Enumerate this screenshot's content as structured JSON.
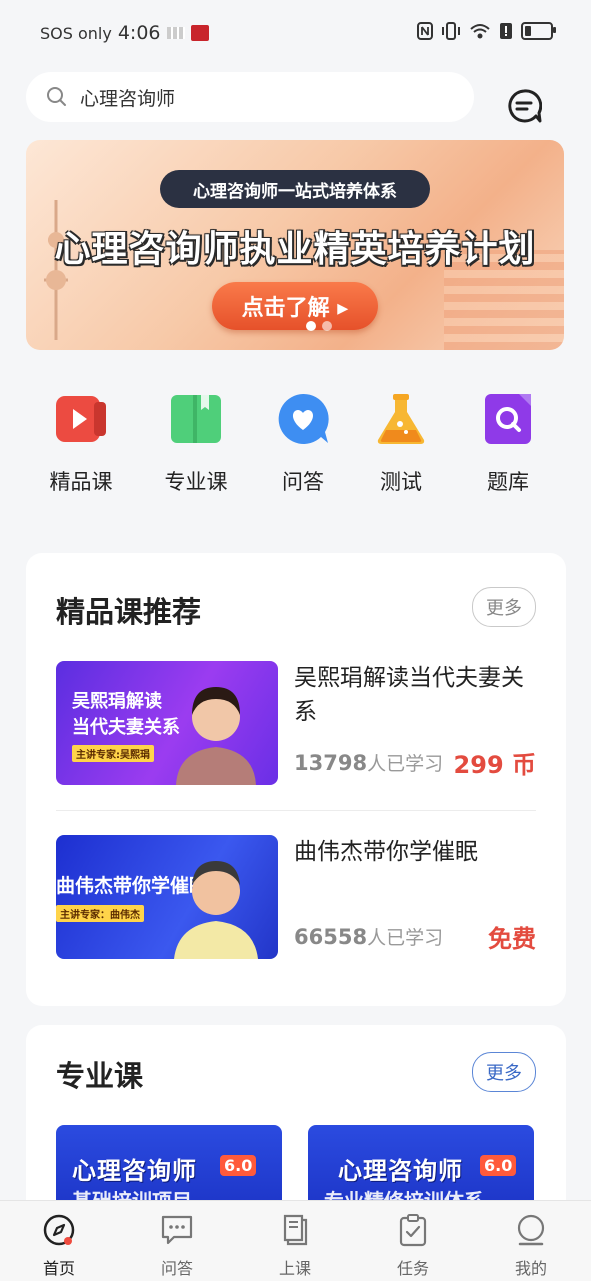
{
  "status_bar": {
    "carrier": "SOS only",
    "time": "4:06"
  },
  "search": {
    "value": "心理咨询师"
  },
  "banner": {
    "pill": "心理咨询师一站式培养体系",
    "title": "心理咨询师执业精英培养计划",
    "cta": "点击了解 ▸"
  },
  "categories": [
    {
      "label": "精品课",
      "icon": "video-play-icon",
      "color": "#ec4b41"
    },
    {
      "label": "专业课",
      "icon": "book-icon",
      "color": "#4fcf7a"
    },
    {
      "label": "问答",
      "icon": "chat-heart-icon",
      "color": "#3e8ef2"
    },
    {
      "label": "测试",
      "icon": "flask-icon",
      "color": "#f5a623"
    },
    {
      "label": "题库",
      "icon": "search-doc-icon",
      "color": "#8f3ae8"
    }
  ],
  "featured": {
    "title": "精品课推荐",
    "more": "更多",
    "courses": [
      {
        "thumb_line1": "吴熙琄解读",
        "thumb_line2": "当代夫妻关系",
        "thumb_tag": "主讲专家:吴熙琄",
        "title": "吴熙琄解读当代夫妻关系",
        "learners": "13798",
        "learners_suffix": "人已学习",
        "price": "299 币"
      },
      {
        "thumb_line1": "曲伟杰带你学催眠",
        "thumb_tag": "主讲专家：曲伟杰",
        "title": "曲伟杰带你学催眠",
        "learners": "66558",
        "learners_suffix": "人已学习",
        "price": "免费"
      }
    ]
  },
  "professional": {
    "title": "专业课",
    "more": "更多",
    "items": [
      {
        "line1": "心理咨询师",
        "version": "6.0",
        "line2": "基础培训项目"
      },
      {
        "line1": "心理咨询师",
        "version": "6.0",
        "line2": "专业精修培训体系"
      }
    ]
  },
  "tabbar": [
    {
      "label": "首页",
      "icon": "compass-icon",
      "active": true
    },
    {
      "label": "问答",
      "icon": "chat-bubble-icon"
    },
    {
      "label": "上课",
      "icon": "book-stack-icon"
    },
    {
      "label": "任务",
      "icon": "clipboard-check-icon"
    },
    {
      "label": "我的",
      "icon": "profile-icon"
    }
  ],
  "colors": {
    "accent_red": "#e34b3f",
    "accent_blue": "#3a69c6",
    "background": "#f5f6f8"
  }
}
